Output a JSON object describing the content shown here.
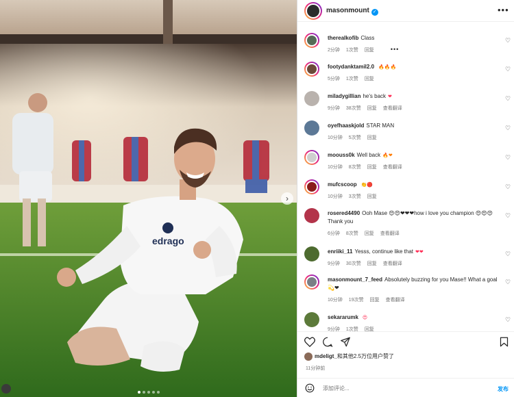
{
  "post": {
    "owner_username": "masonmount",
    "verified_badge": "✓",
    "more_icon": "more-horizontal-icon",
    "images_in_carousel": 5,
    "current_image_index": 1
  },
  "comments": [
    {
      "username": "therealkofib",
      "text": "Class",
      "time": "2分钟",
      "likes": "1次赞",
      "reply": "回复",
      "translate": "",
      "emoji": "",
      "show_more": "•••"
    },
    {
      "username": "footydanktamil2.0",
      "text": "",
      "time": "5分钟",
      "likes": "1次赞",
      "reply": "回复",
      "translate": "",
      "emoji": "🔥🔥🔥",
      "show_more": ""
    },
    {
      "username": "miladygillian",
      "text": "he's back",
      "time": "9分钟",
      "likes": "38次赞",
      "reply": "回复",
      "translate": "查看翻译",
      "emoji": "❤",
      "show_more": ""
    },
    {
      "username": "oyefhaaskjold",
      "text": "STAR MAN",
      "time": "10分钟",
      "likes": "5次赞",
      "reply": "回复",
      "translate": "",
      "emoji": "",
      "show_more": ""
    },
    {
      "username": "moouss0k",
      "text": "Well back",
      "time": "10分钟",
      "likes": "8次赞",
      "reply": "回复",
      "translate": "查看翻译",
      "emoji": "🔥❤",
      "show_more": ""
    },
    {
      "username": "mufcscoop",
      "text": "",
      "time": "10分钟",
      "likes": "3次赞",
      "reply": "回复",
      "translate": "",
      "emoji": "👏🔴",
      "show_more": ""
    },
    {
      "username": "rosered4490",
      "text": "Ooh Mase 😍😍❤❤❤how i love you champion 😍😍😍Thank you",
      "time": "6分钟",
      "likes": "8次赞",
      "reply": "回复",
      "translate": "查看翻译",
      "emoji": "",
      "show_more": ""
    },
    {
      "username": "enriiki_11",
      "text": "Yesss, continue like that",
      "time": "9分钟",
      "likes": "30次赞",
      "reply": "回复",
      "translate": "查看翻译",
      "emoji": "❤❤",
      "show_more": ""
    },
    {
      "username": "masonmount_7_feed",
      "text": "Absolutely buzzing for you Mase!! What a goal 💫❤",
      "time": "10分钟",
      "likes": "19次赞",
      "reply": "回复",
      "translate": "查看翻译",
      "emoji": "",
      "show_more": ""
    },
    {
      "username": "sekararumk",
      "text": "",
      "time": "9分钟",
      "likes": "1次赞",
      "reply": "回复",
      "translate": "",
      "emoji": "😍",
      "show_more": ""
    }
  ],
  "actions": {
    "like_icon": "heart-icon",
    "comment_icon": "comment-icon",
    "share_icon": "share-icon",
    "save_icon": "bookmark-icon"
  },
  "likes": {
    "first_user": "mdeligt_",
    "suffix": "和其他2.5万位用户赞了"
  },
  "posted_time": "11分钟前",
  "add_comment": {
    "placeholder": "添加评论...",
    "post_label": "发布",
    "emoji_icon": "smile-icon"
  },
  "colors": {
    "accent_blue": "#0095f6",
    "story_ring_start": "#f9ce34",
    "story_ring_mid": "#ee2a7b",
    "story_ring_end": "#6228d7",
    "muted_text": "#737373"
  }
}
